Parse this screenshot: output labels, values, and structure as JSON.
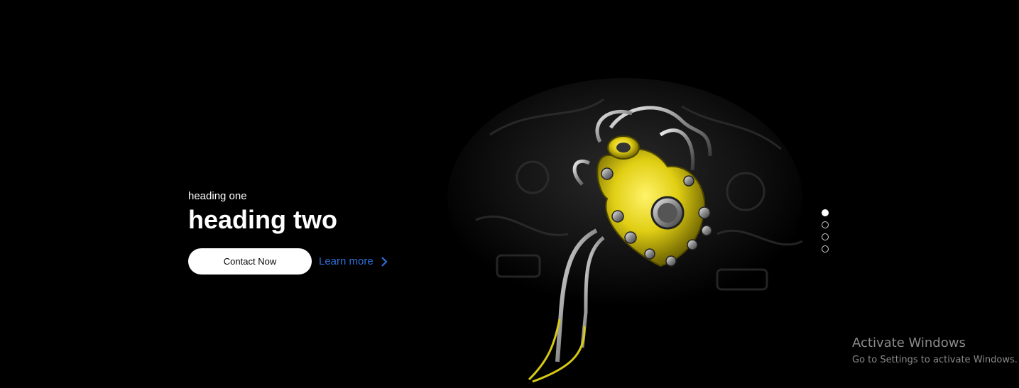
{
  "hero": {
    "heading_one": "heading one",
    "heading_two": "heading two",
    "contact_label": "Contact Now",
    "learn_more_label": "Learn more"
  },
  "slider": {
    "dots": 4,
    "active_index": 0
  },
  "watermark": {
    "title": "Activate Windows",
    "subtitle": "Go to Settings to activate Windows."
  },
  "colors": {
    "background": "#000000",
    "accent_link": "#2e6fd8",
    "heart_yellow": "#e8d81a",
    "text": "#ffffff"
  },
  "icons": {
    "learn_more": "chevron-right-icon",
    "image": "mechanical-heart-image"
  }
}
